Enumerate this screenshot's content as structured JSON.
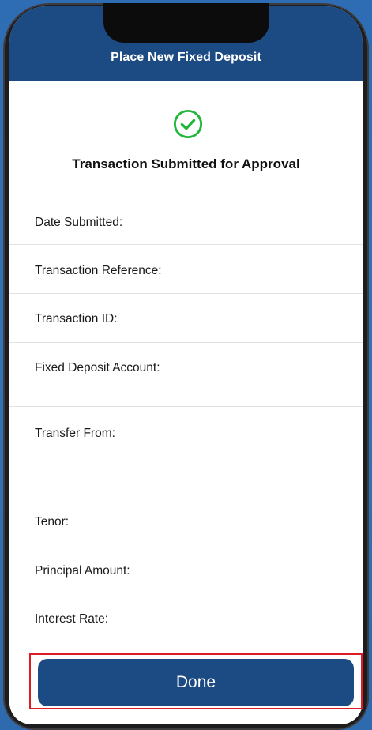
{
  "header": {
    "title": "Place New Fixed Deposit"
  },
  "status": {
    "icon": "check-circle-icon",
    "color": "#1fb536",
    "title": "Transaction Submitted for Approval"
  },
  "details": {
    "date_submitted": "Date Submitted:",
    "transaction_reference": "Transaction Reference:",
    "transaction_id": "Transaction ID:",
    "fixed_deposit_account": "Fixed Deposit Account:",
    "transfer_from": "Transfer From:",
    "tenor": "Tenor:",
    "principal_amount": "Principal Amount:",
    "interest_rate": "Interest Rate:"
  },
  "footer": {
    "done_label": "Done"
  },
  "colors": {
    "brand": "#1c4a82",
    "background": "#2f6cb1",
    "highlight": "#e01b24"
  }
}
